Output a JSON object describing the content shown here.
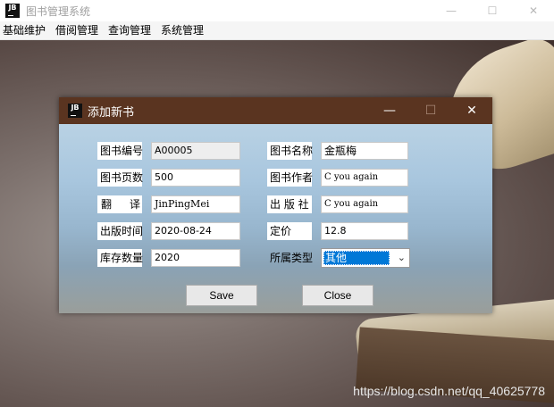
{
  "app": {
    "title": "图书管理系统",
    "logo": "JB"
  },
  "window_controls": {
    "minimize": "—",
    "maximize": "☐",
    "close": "✕"
  },
  "menu": [
    "基础维护",
    "借阅管理",
    "查询管理",
    "系统管理"
  ],
  "dialog": {
    "title": "添加新书",
    "logo": "JB",
    "controls": {
      "minimize": "—",
      "maximize": "☐",
      "close": "✕"
    },
    "fields": {
      "book_id": {
        "label": "图书编号",
        "value": "A00005"
      },
      "book_name": {
        "label": "图书名称",
        "value": "金瓶梅"
      },
      "pages": {
        "label": "图书页数",
        "value": "500"
      },
      "author": {
        "label": "图书作者",
        "value": "C you again"
      },
      "translator": {
        "label": "翻　译",
        "value": "JinPingMei"
      },
      "publisher": {
        "label": "出 版 社",
        "value": "C you again"
      },
      "pub_date": {
        "label": "出版时间",
        "value": "2020-08-24"
      },
      "price": {
        "label": "定价",
        "value": "12.8"
      },
      "stock": {
        "label": "库存数量",
        "value": "2020"
      },
      "category": {
        "label": "所属类型",
        "value": "其他"
      }
    },
    "buttons": {
      "save": "Save",
      "close": "Close"
    }
  },
  "watermark": "https://blog.csdn.net/qq_40625778",
  "colors": {
    "dialog_title_bg": "#5a3420",
    "select_highlight": "#0078d7"
  }
}
